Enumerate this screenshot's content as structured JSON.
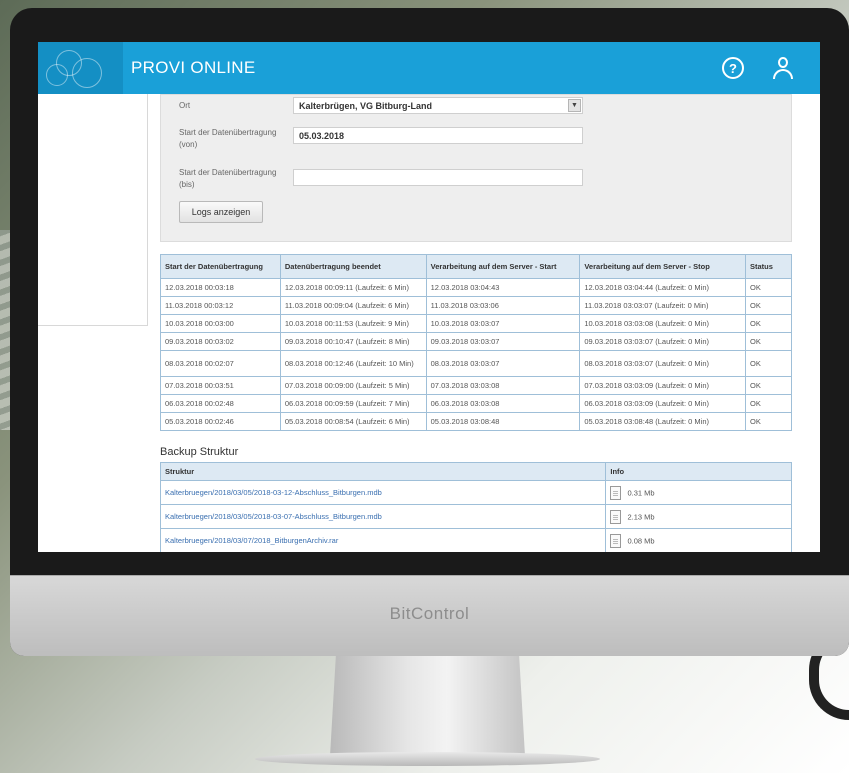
{
  "app": {
    "title": "PROVI ONLINE"
  },
  "header_icons": {
    "help": "help-icon",
    "user": "user-icon"
  },
  "form": {
    "location_label": "Ort",
    "location_value": "Kalterbrügen, VG Bitburg-Land",
    "start_label": "Start der Datenübertragung (von)",
    "start_value": "05.03.2018",
    "end_label": "Start der Datenübertragung (bis)",
    "end_value": "",
    "show_logs_button": "Logs anzeigen"
  },
  "log_table": {
    "headers": [
      "Start der Datenübertragung",
      "Datenübertragung beendet",
      "Verarbeitung auf dem Server - Start",
      "Verarbeitung auf dem Server - Stop",
      "Status"
    ],
    "rows": [
      [
        "12.03.2018 00:03:18",
        "12.03.2018 00:09:11 (Laufzeit: 6 Min)",
        "12.03.2018 03:04:43",
        "12.03.2018 03:04:44 (Laufzeit: 0 Min)",
        "OK"
      ],
      [
        "11.03.2018 00:03:12",
        "11.03.2018 00:09:04 (Laufzeit: 6 Min)",
        "11.03.2018 03:03:06",
        "11.03.2018 03:03:07 (Laufzeit: 0 Min)",
        "OK"
      ],
      [
        "10.03.2018 00:03:00",
        "10.03.2018 00:11:53 (Laufzeit: 9 Min)",
        "10.03.2018 03:03:07",
        "10.03.2018 03:03:08 (Laufzeit: 0 Min)",
        "OK"
      ],
      [
        "09.03.2018 00:03:02",
        "09.03.2018 00:10:47 (Laufzeit: 8 Min)",
        "09.03.2018 03:03:07",
        "09.03.2018 03:03:07 (Laufzeit: 0 Min)",
        "OK"
      ],
      [
        "08.03.2018 00:02:07",
        "08.03.2018 00:12:46 (Laufzeit: 10 Min)",
        "08.03.2018 03:03:07",
        "08.03.2018 03:03:07 (Laufzeit: 0 Min)",
        "OK"
      ],
      [
        "07.03.2018 00:03:51",
        "07.03.2018 00:09:00 (Laufzeit: 5 Min)",
        "07.03.2018 03:03:08",
        "07.03.2018 03:03:09 (Laufzeit: 0 Min)",
        "OK"
      ],
      [
        "06.03.2018 00:02:48",
        "06.03.2018 00:09:59 (Laufzeit: 7 Min)",
        "06.03.2018 03:03:08",
        "06.03.2018 03:03:09 (Laufzeit: 0 Min)",
        "OK"
      ],
      [
        "05.03.2018 00:02:46",
        "05.03.2018 00:08:54 (Laufzeit: 6 Min)",
        "05.03.2018 03:08:48",
        "05.03.2018 03:08:48 (Laufzeit: 0 Min)",
        "OK"
      ]
    ]
  },
  "backup": {
    "title": "Backup Struktur",
    "headers": [
      "Struktur",
      "Info"
    ],
    "rows": [
      {
        "name": "Kalterbruegen/2018/03/05/2018-03-12-Abschluss_Bitburgen.mdb",
        "size": "0.31 Mb"
      },
      {
        "name": "Kalterbruegen/2018/03/05/2018-03-07-Abschluss_Bitburgen.mdb",
        "size": "2.13 Mb"
      },
      {
        "name": "Kalterbruegen/2018/03/07/2018_BitburgenArchiv.rar",
        "size": "0.08 Mb"
      }
    ]
  },
  "monitor_brand": "BitControl"
}
